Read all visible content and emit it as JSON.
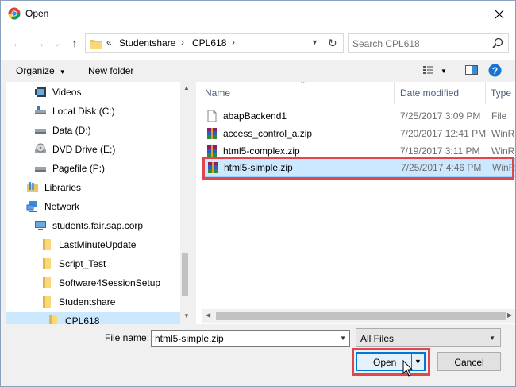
{
  "window": {
    "title": "Open",
    "close": "✕"
  },
  "nav": {
    "back": "←",
    "forward": "→",
    "recent": "⌄",
    "up": "↑",
    "breadcrumbs": [
      "«",
      "Studentshare",
      "›",
      "CPL618",
      "›"
    ],
    "search_placeholder": "Search CPL618"
  },
  "toolbar": {
    "organize": "Organize",
    "new_folder": "New folder"
  },
  "tree": [
    {
      "label": "Videos",
      "icon": "videos-icon"
    },
    {
      "label": "Local Disk (C:)",
      "icon": "local-disk-icon"
    },
    {
      "label": "Data (D:)",
      "icon": "drive-icon"
    },
    {
      "label": "DVD Drive (E:)",
      "icon": "dvd-drive-icon"
    },
    {
      "label": "Pagefile (P:)",
      "icon": "drive-icon"
    },
    {
      "label": "Libraries",
      "icon": "libraries-icon"
    },
    {
      "label": "Network",
      "icon": "network-icon"
    },
    {
      "label": "students.fair.sap.corp",
      "icon": "computer-icon"
    },
    {
      "label": "LastMinuteUpdate",
      "icon": "folder-icon"
    },
    {
      "label": "Script_Test",
      "icon": "folder-icon"
    },
    {
      "label": "Software4SessionSetup",
      "icon": "folder-icon"
    },
    {
      "label": "Studentshare",
      "icon": "folder-icon"
    },
    {
      "label": "CPL618",
      "icon": "folder-icon"
    }
  ],
  "columns": {
    "name": "Name",
    "date": "Date modified",
    "type": "Type"
  },
  "files": [
    {
      "name": "abapBackend1",
      "date": "7/25/2017 3:09 PM",
      "type": "File",
      "icon": "file-icon"
    },
    {
      "name": "access_control_a.zip",
      "date": "7/20/2017 12:41 PM",
      "type": "WinR",
      "icon": "winrar-archive-icon"
    },
    {
      "name": "html5-complex.zip",
      "date": "7/19/2017 3:11 PM",
      "type": "WinR",
      "icon": "winrar-archive-icon"
    },
    {
      "name": "html5-simple.zip",
      "date": "7/25/2017 4:46 PM",
      "type": "WinR",
      "icon": "winrar-archive-icon",
      "selected": true
    }
  ],
  "footer": {
    "file_name_label": "File name:",
    "file_name_value": "html5-simple.zip",
    "file_type": "All Files",
    "open": "Open",
    "cancel": "Cancel"
  },
  "colors": {
    "selection": "#cce8ff",
    "highlight_annotation": "#e0474c",
    "accent": "#0078d7"
  }
}
